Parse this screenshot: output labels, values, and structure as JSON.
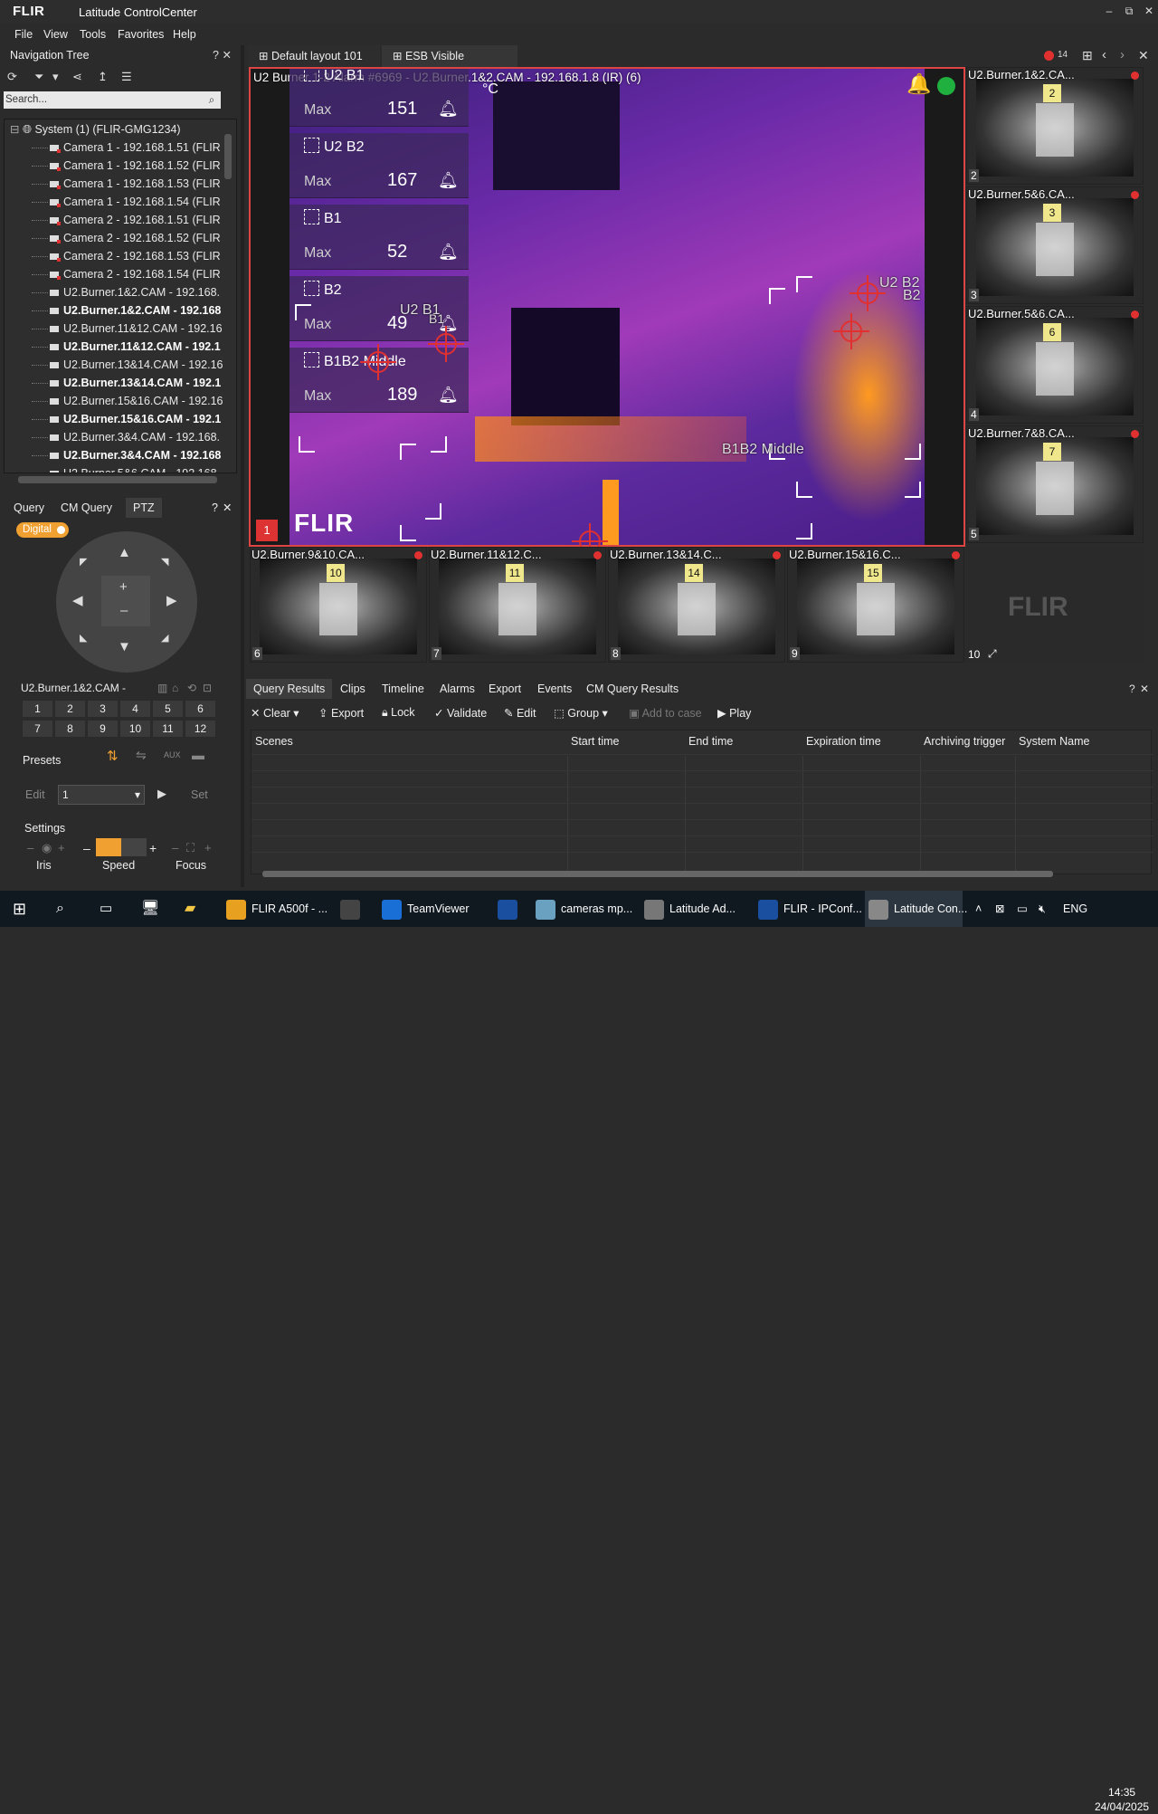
{
  "app": {
    "logo": "FLIR",
    "title": "Latitude ControlCenter"
  },
  "window_controls": [
    "–",
    "⧉",
    "✕"
  ],
  "menu": [
    "File",
    "View",
    "Tools",
    "Favorites",
    "Help"
  ],
  "nav": {
    "title": "Navigation Tree",
    "help": "?",
    "close": "✕",
    "search_placeholder": "Search...",
    "tree": [
      {
        "label": "System (1) (FLIR-GMG1234)",
        "bold": false,
        "type": "system"
      },
      {
        "label": "Camera 1 - 192.168.1.51 (FLIR",
        "bold": false,
        "type": "red"
      },
      {
        "label": "Camera 1 - 192.168.1.52 (FLIR",
        "bold": false,
        "type": "red"
      },
      {
        "label": "Camera 1 - 192.168.1.53 (FLIR",
        "bold": false,
        "type": "red"
      },
      {
        "label": "Camera 1 - 192.168.1.54 (FLIR",
        "bold": false,
        "type": "red"
      },
      {
        "label": "Camera 2 - 192.168.1.51 (FLIR",
        "bold": false,
        "type": "red"
      },
      {
        "label": "Camera 2 - 192.168.1.52 (FLIR",
        "bold": false,
        "type": "red"
      },
      {
        "label": "Camera 2 - 192.168.1.53 (FLIR",
        "bold": false,
        "type": "red"
      },
      {
        "label": "Camera 2 - 192.168.1.54 (FLIR",
        "bold": false,
        "type": "red"
      },
      {
        "label": "U2.Burner.1&2.CAM - 192.168.",
        "bold": false,
        "type": "cam"
      },
      {
        "label": "U2.Burner.1&2.CAM - 192.168",
        "bold": true,
        "type": "cam"
      },
      {
        "label": "U2.Burner.11&12.CAM - 192.16",
        "bold": false,
        "type": "cam"
      },
      {
        "label": "U2.Burner.11&12.CAM - 192.1",
        "bold": true,
        "type": "cam"
      },
      {
        "label": "U2.Burner.13&14.CAM - 192.16",
        "bold": false,
        "type": "cam"
      },
      {
        "label": "U2.Burner.13&14.CAM - 192.1",
        "bold": true,
        "type": "cam"
      },
      {
        "label": "U2.Burner.15&16.CAM - 192.16",
        "bold": false,
        "type": "cam"
      },
      {
        "label": "U2.Burner.15&16.CAM - 192.1",
        "bold": true,
        "type": "cam"
      },
      {
        "label": "U2.Burner.3&4.CAM - 192.168.",
        "bold": false,
        "type": "cam"
      },
      {
        "label": "U2.Burner.3&4.CAM - 192.168",
        "bold": true,
        "type": "cam"
      },
      {
        "label": "U2.Burner.5&6.CAM - 192.168",
        "bold": false,
        "type": "cam"
      }
    ]
  },
  "ptz": {
    "tabs": [
      "Query",
      "CM Query",
      "PTZ"
    ],
    "active_tab": "PTZ",
    "digital": "Digital",
    "camera": "U2.Burner.1&2.CAM -",
    "presets_numbers": [
      "1",
      "2",
      "3",
      "4",
      "5",
      "6",
      "7",
      "8",
      "9",
      "10",
      "11",
      "12"
    ],
    "presets_label": "Presets",
    "aux": "AUX",
    "edit": "Edit",
    "preset_value": "1",
    "set": "Set",
    "settings_label": "Settings",
    "iris": "Iris",
    "speed": "Speed",
    "focus": "Focus",
    "speed_level": 0.5
  },
  "view_tabs": [
    {
      "label": "Default layout 101",
      "active": true
    },
    {
      "label": "ESB Visible",
      "active": false
    }
  ],
  "view_alarm_count": "14",
  "main_view": {
    "title": "U2 Burner 1-2 Alarm #6969 - U2.Burner.1&2.CAM - 192.168.1.8 (IR) (6)",
    "unit": "°C",
    "index": "1",
    "watermark": "FLIR",
    "measurements": [
      {
        "name": "U2 B1",
        "max_label": "Max",
        "value": "151"
      },
      {
        "name": "U2 B2",
        "max_label": "Max",
        "value": "167"
      },
      {
        "name": "B1",
        "max_label": "Max",
        "value": "52"
      },
      {
        "name": "B2",
        "max_label": "Max",
        "value": "49"
      },
      {
        "name": "B1B2 Middle",
        "max_label": "Max",
        "value": "189"
      }
    ],
    "overlay_labels": {
      "u2b1": "U2 B1",
      "b1": "B1",
      "u2b2": "U2 B2",
      "b2": "B2",
      "middle": "B1B2 Middle"
    }
  },
  "side_thumbs": [
    {
      "label": "U2.Burner.1&2.CA...",
      "tag": "2",
      "idx": "2"
    },
    {
      "label": "U2.Burner.5&6.CA...",
      "tag": "3",
      "idx": "3"
    },
    {
      "label": "U2.Burner.5&6.CA...",
      "tag": "6",
      "idx": "4"
    },
    {
      "label": "U2.Burner.7&8.CA...",
      "tag": "7",
      "idx": "5"
    }
  ],
  "bottom_thumbs": [
    {
      "label": "U2.Burner.9&10.CA...",
      "tag": "10",
      "idx": "6"
    },
    {
      "label": "U2.Burner.11&12.C...",
      "tag": "11",
      "idx": "7"
    },
    {
      "label": "U2.Burner.13&14.C...",
      "tag": "14",
      "idx": "8"
    },
    {
      "label": "U2.Burner.15&16.C...",
      "tag": "15",
      "idx": "9"
    }
  ],
  "flir_tile": {
    "logo": "FLIR",
    "idx": "10"
  },
  "results": {
    "tabs": [
      "Query Results",
      "Clips",
      "Timeline",
      "Alarms",
      "Export",
      "Events",
      "CM Query Results"
    ],
    "active_tab": "Query Results",
    "tools": {
      "clear": "Clear",
      "export": "Export",
      "lock": "Lock",
      "validate": "Validate",
      "edit": "Edit",
      "group": "Group",
      "add_to_case": "Add to case",
      "play": "Play"
    },
    "columns": [
      "Scenes",
      "Start time",
      "End time",
      "Expiration time",
      "Archiving trigger",
      "System Name"
    ]
  },
  "taskbar": {
    "items": [
      {
        "label": "FLIR A500f - ...",
        "color": "#e8a020"
      },
      {
        "label": "",
        "color": "#444"
      },
      {
        "label": "TeamViewer",
        "color": "#1a6fd6"
      },
      {
        "label": "",
        "color": "#1a4fa0"
      },
      {
        "label": "cameras mp...",
        "color": "#6aa0c0"
      },
      {
        "label": "Latitude Ad...",
        "color": "#777"
      },
      {
        "label": "FLIR - IPConf...",
        "color": "#1a4fa0"
      },
      {
        "label": "Latitude Con...",
        "color": "#888"
      }
    ],
    "lang": "ENG",
    "time": "14:35",
    "date": "24/04/2025"
  }
}
